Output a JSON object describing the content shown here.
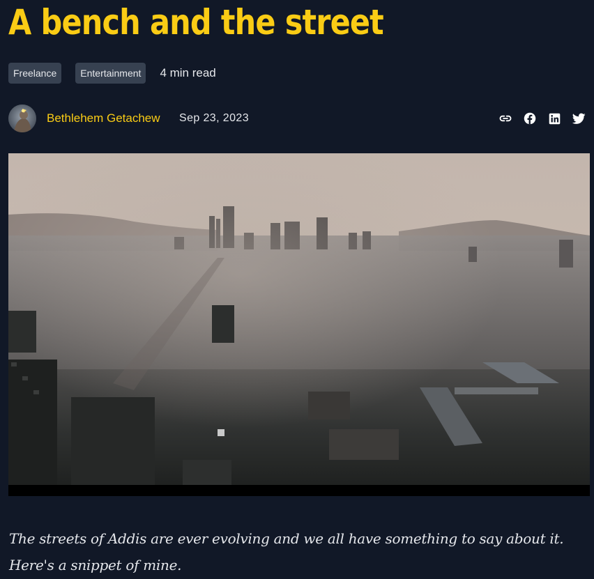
{
  "post": {
    "title": "A bench and the street",
    "tags": [
      "Freelance",
      "Entertainment"
    ],
    "read_time": "4 min read",
    "author": "Bethlehem Getachew",
    "date": "Sep 23, 2023",
    "excerpt": "The streets of Addis are ever evolving and we all have something to say about it. Here's a snippet of mine."
  },
  "share": {
    "icons": [
      "link-icon",
      "facebook-icon",
      "linkedin-icon",
      "twitter-icon"
    ]
  },
  "colors": {
    "background": "#111827",
    "accent": "#facc15",
    "tag_background": "#374151",
    "text": "#e5e7eb"
  }
}
